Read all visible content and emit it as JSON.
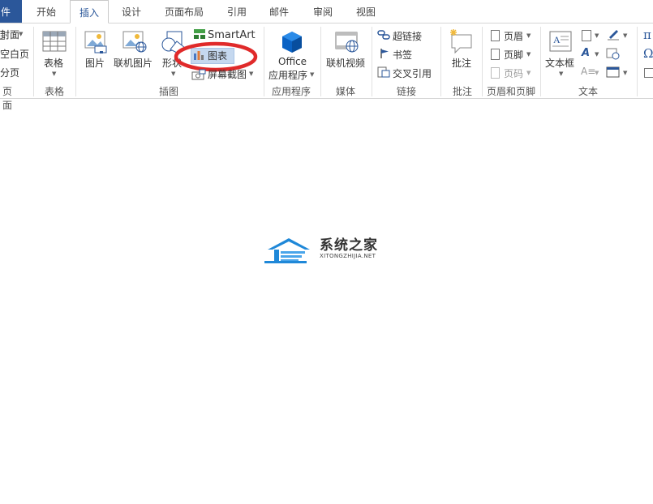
{
  "tabs": [
    {
      "label": "件",
      "id": "file"
    },
    {
      "label": "开始",
      "id": "home"
    },
    {
      "label": "插入",
      "id": "insert"
    },
    {
      "label": "设计",
      "id": "design"
    },
    {
      "label": "页面布局",
      "id": "layout"
    },
    {
      "label": "引用",
      "id": "references"
    },
    {
      "label": "邮件",
      "id": "mailings"
    },
    {
      "label": "审阅",
      "id": "review"
    },
    {
      "label": "视图",
      "id": "view"
    }
  ],
  "pages_group": {
    "cover": "封面",
    "blank": "空白页",
    "break": "分页",
    "label": "页面"
  },
  "tables_group": {
    "table": "表格",
    "label": "表格"
  },
  "illustrations_group": {
    "picture": "图片",
    "online_picture": "联机图片",
    "shapes": "形状",
    "smartart": "SmartArt",
    "chart": "图表",
    "screenshot": "屏幕截图",
    "label": "插图"
  },
  "apps_group": {
    "office_line1": "Office",
    "office_line2": "应用程序",
    "label": "应用程序"
  },
  "media_group": {
    "online_video": "联机视频",
    "label": "媒体"
  },
  "links_group": {
    "hyperlink": "超链接",
    "bookmark": "书签",
    "cross_ref": "交叉引用",
    "label": "链接"
  },
  "comments_group": {
    "comment": "批注",
    "label": "批注"
  },
  "header_footer_group": {
    "header": "页眉",
    "footer": "页脚",
    "page_number": "页码",
    "label": "页眉和页脚"
  },
  "text_group": {
    "textbox": "文本框",
    "label": "文本"
  },
  "symbols_group": {
    "pi": "π",
    "omega": "Ω"
  },
  "watermark": {
    "name": "系统之家",
    "url": "XITONGZHIJIA.NET"
  },
  "colors": {
    "accent": "#2b579a",
    "highlight": "#e02a2a",
    "chart_hover": "#c5d8ef"
  }
}
